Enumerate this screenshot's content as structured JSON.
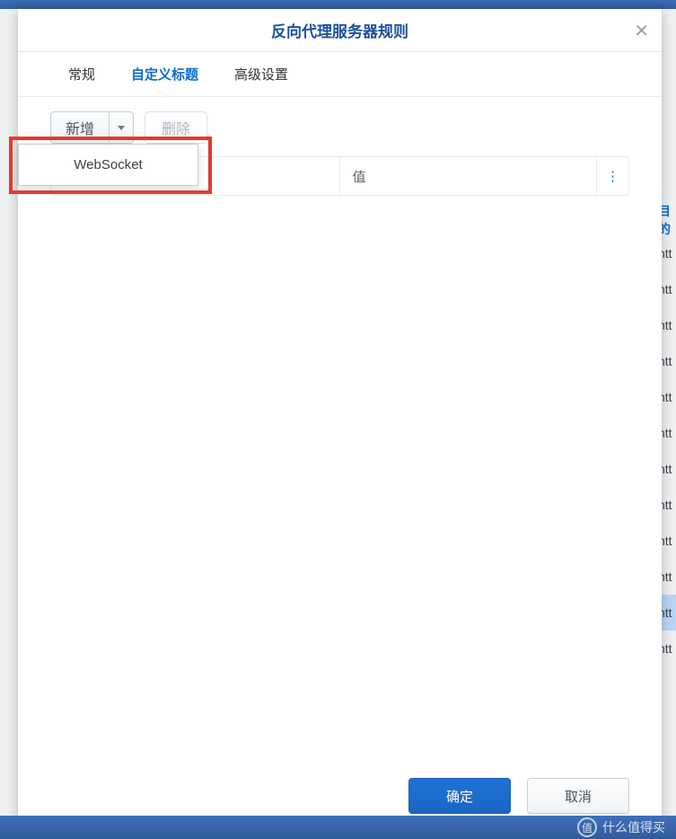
{
  "dialog": {
    "title": "反向代理服务器规则",
    "tabs": [
      "常规",
      "自定义标题",
      "高级设置"
    ],
    "active_tab": 1,
    "toolbar": {
      "add_label": "新增",
      "delete_label": "删除"
    },
    "dropdown": {
      "items": [
        "WebSocket"
      ]
    },
    "table": {
      "col_name": "",
      "col_value": "值",
      "menu_glyph": "⋮"
    },
    "footer": {
      "ok_label": "确定",
      "cancel_label": "取消"
    }
  },
  "background": {
    "header_fragment": "目的",
    "row_text": "htt",
    "row_count": 12,
    "selected_index": 10
  },
  "watermark": {
    "text": "什么值得买",
    "badge": "值"
  }
}
